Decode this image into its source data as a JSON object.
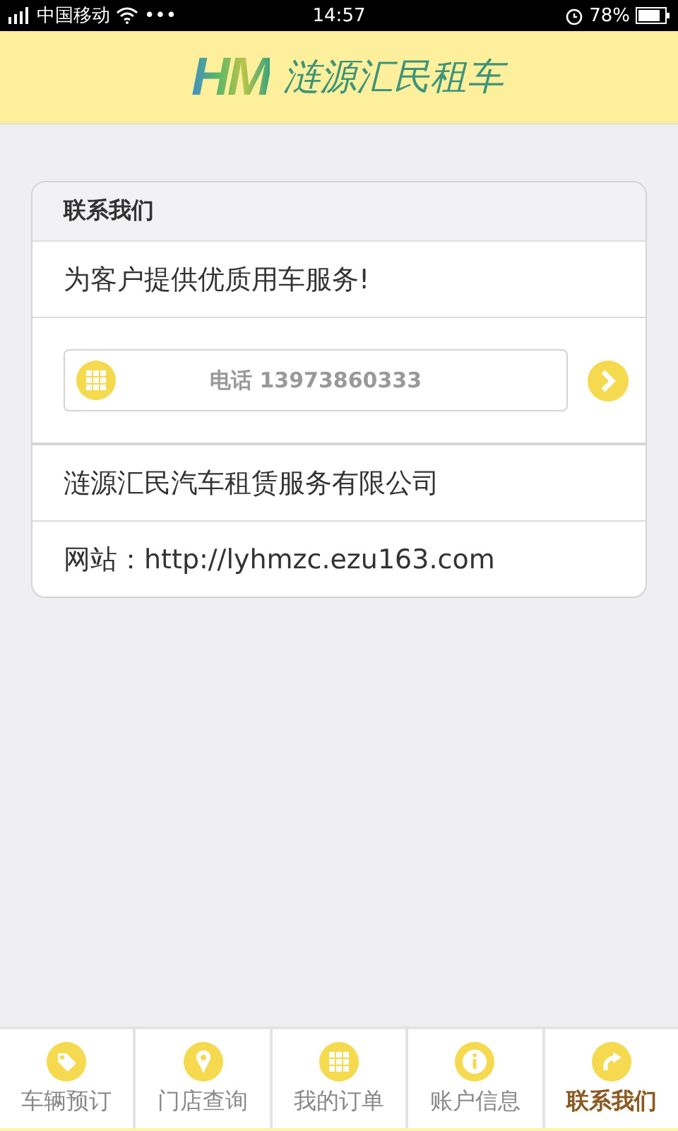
{
  "status_bar": {
    "carrier": "中国移动",
    "more": "•••",
    "time": "14:57",
    "battery": "78%"
  },
  "header": {
    "logo_mark": "HM",
    "brand": "涟源汇民租车"
  },
  "card": {
    "title": "联系我们",
    "slogan": "为客户提供优质用车服务!",
    "phone": {
      "label": "电话 13973860333"
    },
    "company": "涟源汇民汽车租赁服务有限公司",
    "website": "网站：http://lyhmzc.ezu163.com"
  },
  "tabs": [
    {
      "label": "车辆预订",
      "kind": "tag",
      "selected": false
    },
    {
      "label": "门店查询",
      "kind": "pin",
      "selected": false
    },
    {
      "label": "我的订单",
      "kind": "grid",
      "selected": false
    },
    {
      "label": "账户信息",
      "kind": "info",
      "selected": false
    },
    {
      "label": "联系我们",
      "kind": "share",
      "selected": true
    }
  ]
}
